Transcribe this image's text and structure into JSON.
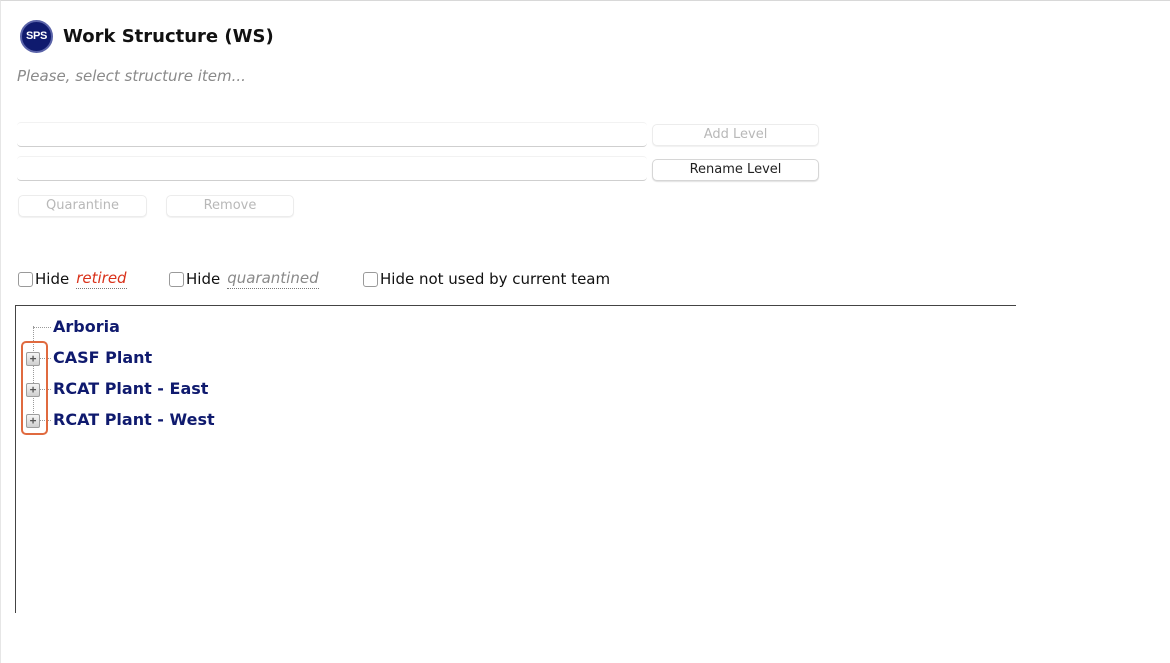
{
  "header": {
    "logo_text": "SPS",
    "title": "Work Structure (WS)",
    "subtitle": "Please, select structure item..."
  },
  "form": {
    "field1_value": "",
    "field2_value": "",
    "add_level_label": "Add Level",
    "rename_level_label": "Rename Level",
    "quarantine_label": "Quarantine",
    "remove_label": "Remove"
  },
  "filters": {
    "hide_label": "Hide",
    "retired_label": "retired",
    "quarantined_label": "quarantined",
    "hide_not_used_label": "Hide not used by current team"
  },
  "tree": {
    "items": [
      {
        "label": "Arboria",
        "expandable": false
      },
      {
        "label": "CASF Plant",
        "expandable": true
      },
      {
        "label": "RCAT Plant - East",
        "expandable": true
      },
      {
        "label": "RCAT Plant - West",
        "expandable": true
      }
    ],
    "expander_glyph": "+"
  },
  "colors": {
    "accent": "#0f1a6e",
    "retired": "#d9321b",
    "highlight": "#e06a3f"
  }
}
